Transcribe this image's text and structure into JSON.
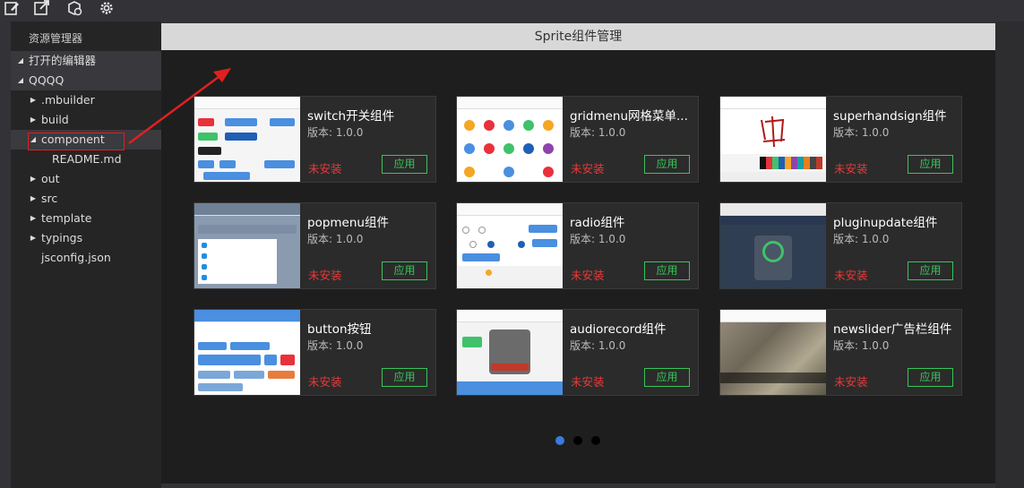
{
  "toolbar": {
    "icons": [
      "edit-icon",
      "export-icon",
      "package-icon",
      "gear-icon"
    ]
  },
  "sidebar": {
    "title": "资源管理器",
    "sections": [
      {
        "label": "打开的编辑器"
      },
      {
        "label": "QQQQ"
      }
    ],
    "items": [
      {
        "label": ".mbuilder"
      },
      {
        "label": "build"
      },
      {
        "label": "component"
      },
      {
        "label": "README.md"
      },
      {
        "label": "out"
      },
      {
        "label": "src"
      },
      {
        "label": "template"
      },
      {
        "label": "typings"
      },
      {
        "label": "jsconfig.json"
      }
    ]
  },
  "main": {
    "title": "Sprite组件管理",
    "cards": [
      {
        "name": "switch开关组件",
        "version": "版本:   1.0.0",
        "status": "未安装",
        "action": "应用"
      },
      {
        "name": "gridmenu网格菜单...",
        "version": "版本:   1.0.0",
        "status": "未安装",
        "action": "应用"
      },
      {
        "name": "superhandsign组件",
        "version": "版本:   1.0.0",
        "status": "未安装",
        "action": "应用"
      },
      {
        "name": "popmenu组件",
        "version": "版本:   1.0.0",
        "status": "未安装",
        "action": "应用"
      },
      {
        "name": "radio组件",
        "version": "版本:   1.0.0",
        "status": "未安装",
        "action": "应用"
      },
      {
        "name": "pluginupdate组件",
        "version": "版本:   1.0.0",
        "status": "未安装",
        "action": "应用"
      },
      {
        "name": "button按钮",
        "version": "版本:   1.0.0",
        "status": "未安装",
        "action": "应用"
      },
      {
        "name": "audiorecord组件",
        "version": "版本:   1.0.0",
        "status": "未安装",
        "action": "应用"
      },
      {
        "name": "newslider广告栏组件",
        "version": "版本:   1.0.0",
        "status": "未安装",
        "action": "应用"
      }
    ],
    "pagination": {
      "pages": 3,
      "current": 1
    }
  },
  "colors": {
    "accent": "#38c45a",
    "not_installed": "#e83a3a",
    "annotation": "#e02020",
    "page_active": "#3b7be0"
  }
}
